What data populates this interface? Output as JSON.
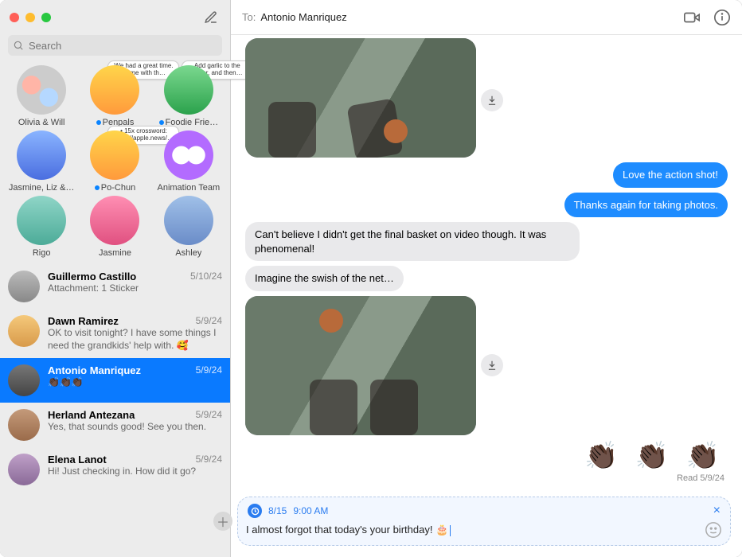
{
  "header": {
    "to_label": "To:",
    "to_name": "Antonio Manriquez"
  },
  "search": {
    "placeholder": "Search"
  },
  "pinned": [
    {
      "name": "Olivia & Will",
      "unread": false,
      "av": "duo",
      "preview": null
    },
    {
      "name": "Penpals",
      "unread": true,
      "av": "solo1",
      "preview": "We had a great time. Home with th…"
    },
    {
      "name": "Foodie Frie…",
      "unread": true,
      "av": "solo2",
      "preview": "Add garlic to the butter, and then…"
    },
    {
      "name": "Jasmine, Liz &…",
      "unread": false,
      "av": "multi",
      "preview": null
    },
    {
      "name": "Po-Chun",
      "unread": true,
      "av": "solo1",
      "preview": "• 15x crossword: https://apple.news/…"
    },
    {
      "name": "Animation Team",
      "unread": false,
      "av": "eyes",
      "preview": null
    },
    {
      "name": "Rigo",
      "unread": false,
      "av": "rigo",
      "preview": null
    },
    {
      "name": "Jasmine",
      "unread": false,
      "av": "jas",
      "preview": null
    },
    {
      "name": "Ashley",
      "unread": false,
      "av": "ash",
      "preview": null
    }
  ],
  "conversations": [
    {
      "name": "Guillermo Castillo",
      "date": "5/10/24",
      "preview": "Attachment: 1 Sticker",
      "selected": false,
      "av": "g1"
    },
    {
      "name": "Dawn Ramirez",
      "date": "5/9/24",
      "preview": "OK to visit tonight? I have some things I need the grandkids' help with. 🥰",
      "selected": false,
      "av": "g2"
    },
    {
      "name": "Antonio Manriquez",
      "date": "5/9/24",
      "preview": "👏🏿👏🏿👏🏿",
      "selected": true,
      "av": "g3"
    },
    {
      "name": "Herland Antezana",
      "date": "5/9/24",
      "preview": "Yes, that sounds good! See you then.",
      "selected": false,
      "av": "g4"
    },
    {
      "name": "Elena Lanot",
      "date": "5/9/24",
      "preview": "Hi! Just checking in. How did it go?",
      "selected": false,
      "av": "g5"
    }
  ],
  "transcript": {
    "msg_out_1": "Love the action shot!",
    "msg_out_2": "Thanks again for taking photos.",
    "msg_in_1": "Can't believe I didn't get the final basket on video though. It was phenomenal!",
    "msg_in_2": "Imagine the swish of the net…",
    "emoji_claps": "👏🏿 👏🏿 👏🏿",
    "read_receipt": "Read 5/9/24"
  },
  "compose": {
    "scheduled_date": "8/15",
    "scheduled_time": "9:00 AM",
    "draft": "I almost forgot that today's your birthday! 🎂"
  }
}
